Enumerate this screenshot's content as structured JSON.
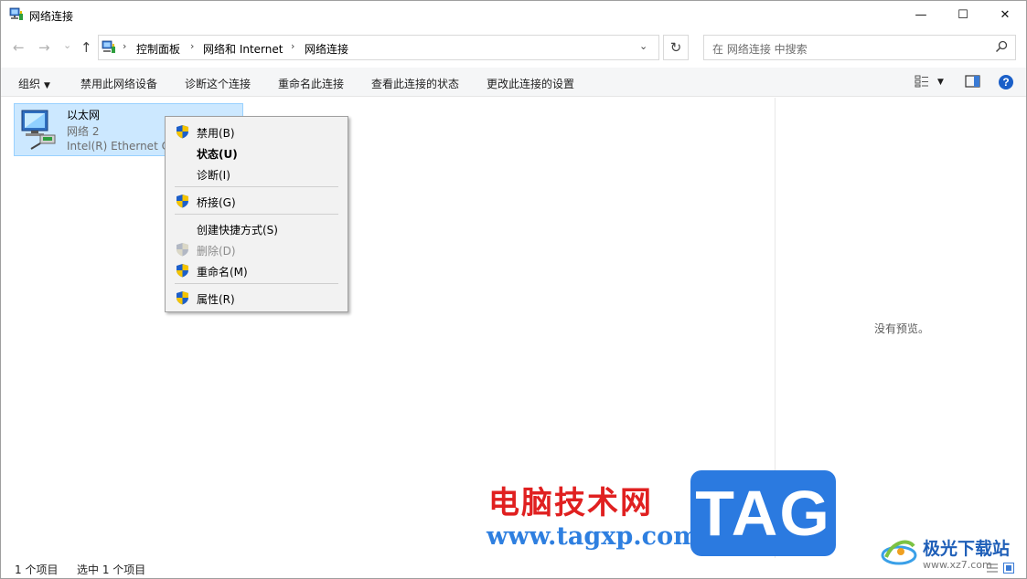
{
  "window": {
    "title": "网络连接",
    "min_glyph": "—",
    "max_glyph": "☐",
    "close_glyph": "✕"
  },
  "nav": {
    "back_glyph": "←",
    "forward_glyph": "→",
    "recent_glyph": "⌄",
    "up_glyph": "↑"
  },
  "address": {
    "crumbs": [
      "控制面板",
      "网络和 Internet",
      "网络连接"
    ],
    "sep_glyph": "›",
    "dropdown_glyph": "⌄",
    "refresh_glyph": "↻"
  },
  "search": {
    "placeholder": "在 网络连接 中搜索"
  },
  "toolbar": {
    "organize": "组织",
    "caret": "▼",
    "disable_device": "禁用此网络设备",
    "diagnose": "诊断这个连接",
    "rename": "重命名此连接",
    "view_status": "查看此连接的状态",
    "change_settings": "更改此连接的设置",
    "help_glyph": "?"
  },
  "connection": {
    "name": "以太网",
    "network": "网络 2",
    "device": "Intel(R) Ethernet Connection"
  },
  "context_menu": {
    "items": [
      {
        "label": "禁用(B)",
        "shield": true
      },
      {
        "label": "状态(U)",
        "bold": true
      },
      {
        "label": "诊断(I)"
      },
      {
        "label": "桥接(G)",
        "shield": true
      },
      {
        "label": "创建快捷方式(S)"
      },
      {
        "label": "删除(D)",
        "shield": true,
        "disabled": true
      },
      {
        "label": "重命名(M)",
        "shield": true
      },
      {
        "label": "属性(R)",
        "shield": true
      }
    ]
  },
  "preview": {
    "text": "没有预览。"
  },
  "status": {
    "item_count": "1 个项目",
    "selected": "选中 1 个项目"
  },
  "watermark": {
    "site_cn": "电脑技术网",
    "site_url": "www.tagxp.com",
    "tag": "TAG",
    "xz_cn": "极光下载站",
    "xz_url": "www.xz7.com"
  },
  "colors": {
    "selection_bg": "#cce8ff",
    "selection_border": "#99d1ff",
    "menu_bg": "#f2f2f2",
    "shield_blue": "#1d5fc9",
    "shield_yellow": "#f5c400",
    "watermark_red": "#e02020",
    "watermark_blue": "#2b7ae0"
  }
}
